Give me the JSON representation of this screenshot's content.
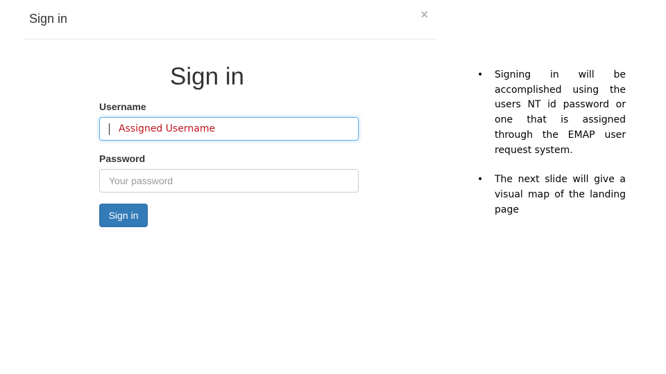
{
  "modal": {
    "title": "Sign in",
    "close_icon": "×"
  },
  "form": {
    "heading": "Sign in",
    "username": {
      "label": "Username",
      "value": "Assigned Username"
    },
    "password": {
      "label": "Password",
      "placeholder": "Your password"
    },
    "submit_label": "Sign in"
  },
  "notes": {
    "bullet": "•",
    "items": [
      "Signing in will be accomplished using the users NT id password or one that is assigned through the EMAP user request system.",
      "The next slide will give a visual map of the landing page"
    ]
  }
}
